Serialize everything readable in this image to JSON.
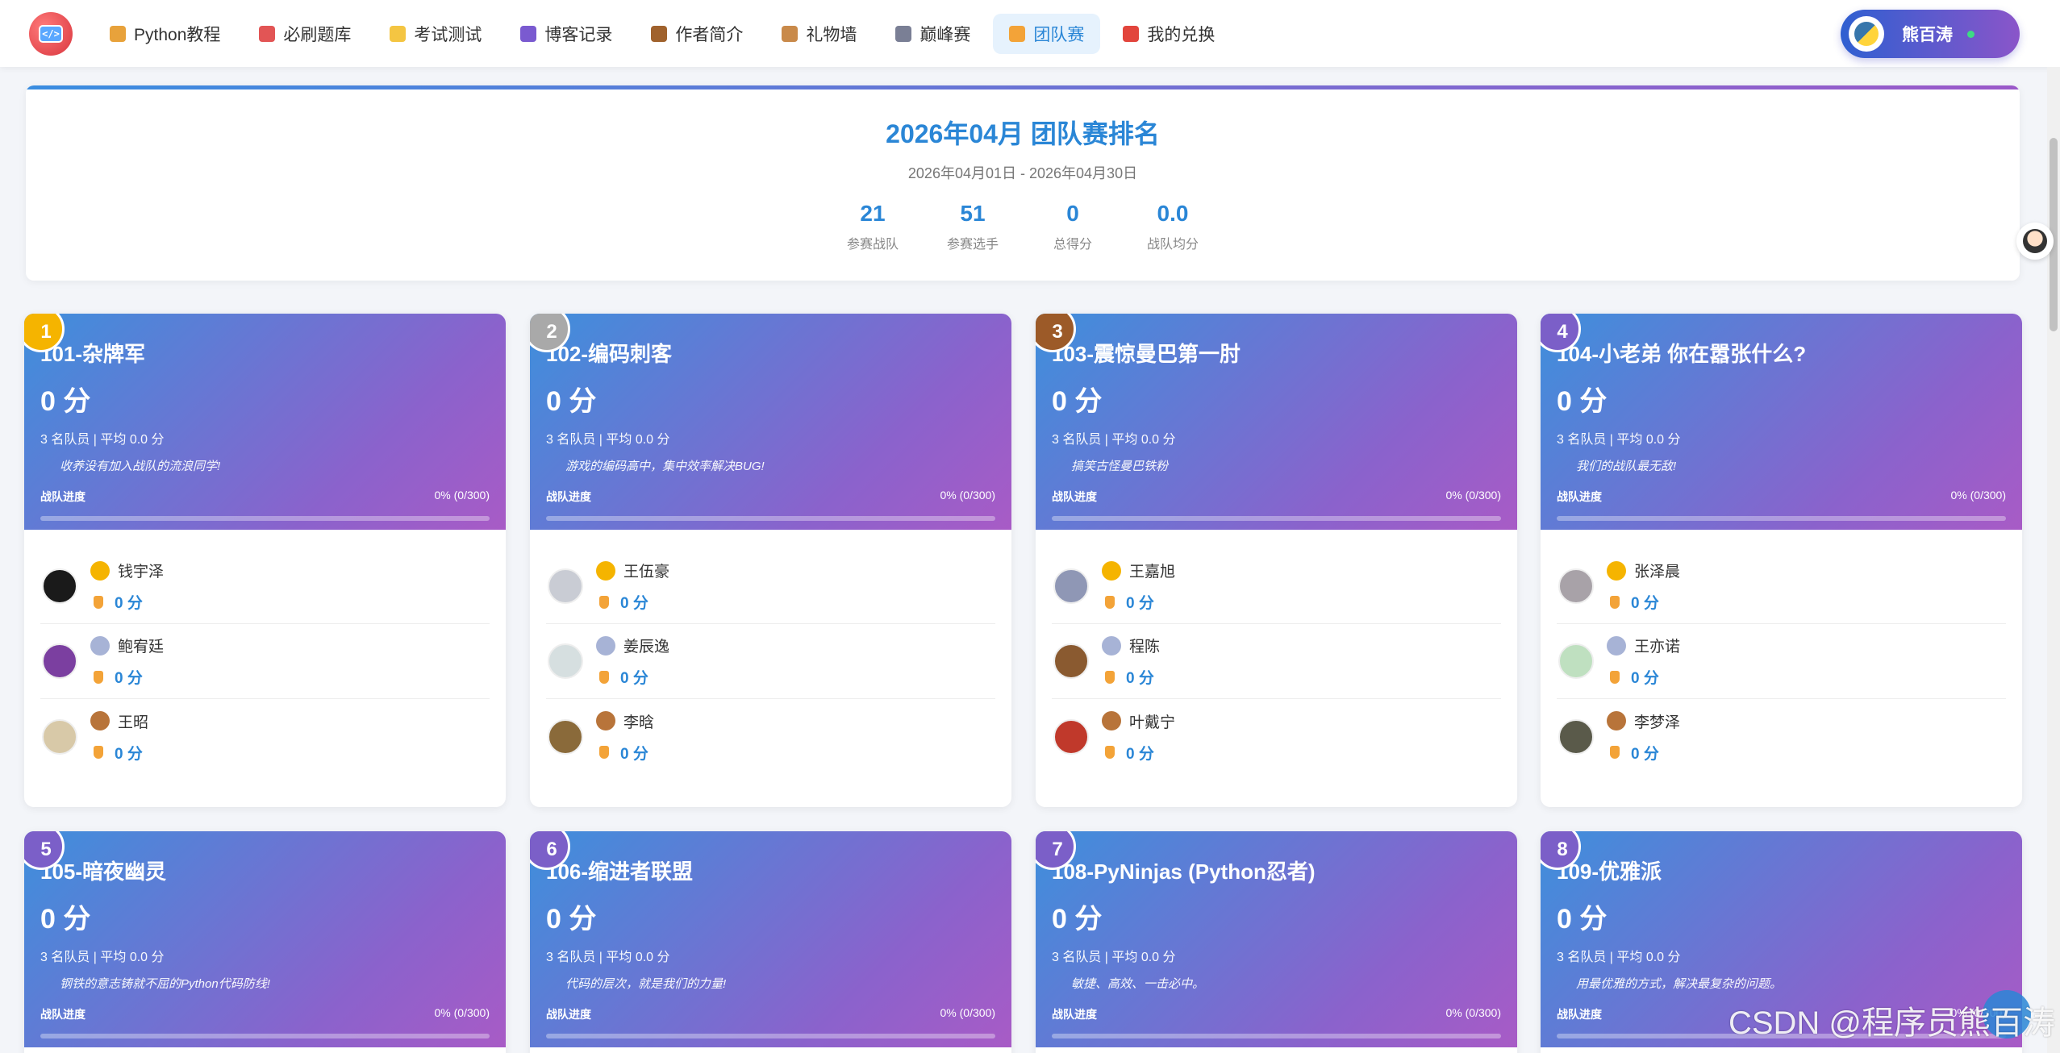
{
  "nav": {
    "items": [
      {
        "label": "Python教程",
        "icon": "scroll-icon",
        "color": "#e8a23b"
      },
      {
        "label": "必刷题库",
        "icon": "book-icon",
        "color": "#e25555"
      },
      {
        "label": "考试测试",
        "icon": "sparkle-icon",
        "color": "#f4c542"
      },
      {
        "label": "博客记录",
        "icon": "ballot-box-icon",
        "color": "#7a5ad0"
      },
      {
        "label": "作者简介",
        "icon": "bear-icon",
        "color": "#a0622d"
      },
      {
        "label": "礼物墙",
        "icon": "package-icon",
        "color": "#c98a4a"
      },
      {
        "label": "巅峰赛",
        "icon": "crossed-swords-icon",
        "color": "#7a7f95"
      },
      {
        "label": "团队赛",
        "icon": "trophy-icon",
        "color": "#f3a338"
      },
      {
        "label": "我的兑换",
        "icon": "gift-icon",
        "color": "#e2453c"
      }
    ],
    "active_index": 7,
    "user_name": "熊百涛"
  },
  "header": {
    "title": "2026年04月 团队赛排名",
    "dates": "2026年04月01日 - 2026年04月30日",
    "stats": [
      {
        "value": "21",
        "label": "参赛战队"
      },
      {
        "value": "51",
        "label": "参赛选手"
      },
      {
        "value": "0",
        "label": "总得分"
      },
      {
        "value": "0.0",
        "label": "战队均分"
      }
    ]
  },
  "teams": [
    {
      "rank": "1",
      "rank_color": "#f5b400",
      "name": "101-杂牌军",
      "score": "0 分",
      "meta": "3 名队员 | 平均 0.0 分",
      "slogan": "收养没有加入战队的流浪同学!",
      "progress_label": "战队进度",
      "progress_text": "0% (0/300)",
      "progress": 0,
      "members": [
        {
          "name": "钱宇泽",
          "score": "0 分",
          "medal": "gold",
          "avatar_color": "#1a1a1a"
        },
        {
          "name": "鲍宥廷",
          "score": "0 分",
          "medal": "silver",
          "avatar_color": "#7b3fa0"
        },
        {
          "name": "王昭",
          "score": "0 分",
          "medal": "bronze",
          "avatar_color": "#d8c9a8"
        }
      ]
    },
    {
      "rank": "2",
      "rank_color": "#a9a9a9",
      "name": "102-编码刺客",
      "score": "0 分",
      "meta": "3 名队员 | 平均 0.0 分",
      "slogan": "游戏的编码高中，集中效率解决BUG!",
      "progress_label": "战队进度",
      "progress_text": "0% (0/300)",
      "progress": 0,
      "members": [
        {
          "name": "王伍豪",
          "score": "0 分",
          "medal": "gold",
          "avatar_color": "#c9ccd4"
        },
        {
          "name": "姜辰逸",
          "score": "0 分",
          "medal": "silver",
          "avatar_color": "#d6dfe0"
        },
        {
          "name": "李晗",
          "score": "0 分",
          "medal": "bronze",
          "avatar_color": "#8a6a3a"
        }
      ]
    },
    {
      "rank": "3",
      "rank_color": "#9c5a28",
      "name": "103-震惊曼巴第一肘",
      "score": "0 分",
      "meta": "3 名队员 | 平均 0.0 分",
      "slogan": "搞笑古怪曼巴铁粉",
      "progress_label": "战队进度",
      "progress_text": "0% (0/300)",
      "progress": 0,
      "members": [
        {
          "name": "王嘉旭",
          "score": "0 分",
          "medal": "gold",
          "avatar_color": "#8f97b5"
        },
        {
          "name": "程陈",
          "score": "0 分",
          "medal": "silver",
          "avatar_color": "#8a5a30"
        },
        {
          "name": "叶戴宁",
          "score": "0 分",
          "medal": "bronze",
          "avatar_color": "#c0392b"
        }
      ]
    },
    {
      "rank": "4",
      "rank_color": "#7b5fc8",
      "name": "104-小老弟 你在嚣张什么?",
      "score": "0 分",
      "meta": "3 名队员 | 平均 0.0 分",
      "slogan": "我们的战队最无敌!",
      "progress_label": "战队进度",
      "progress_text": "0% (0/300)",
      "progress": 0,
      "members": [
        {
          "name": "张泽晨",
          "score": "0 分",
          "medal": "gold",
          "avatar_color": "#a8a2a8"
        },
        {
          "name": "王亦诺",
          "score": "0 分",
          "medal": "silver",
          "avatar_color": "#bfe0c0"
        },
        {
          "name": "李梦泽",
          "score": "0 分",
          "medal": "bronze",
          "avatar_color": "#5a5a4a"
        }
      ]
    },
    {
      "rank": "5",
      "rank_color": "#7b5fc8",
      "name": "105-暗夜幽灵",
      "score": "0 分",
      "meta": "3 名队员 | 平均 0.0 分",
      "slogan": "钢铁的意志铸就不屈的Python代码防线!",
      "progress_label": "战队进度",
      "progress_text": "0% (0/300)",
      "progress": 0,
      "members": []
    },
    {
      "rank": "6",
      "rank_color": "#7b5fc8",
      "name": "106-缩进者联盟",
      "score": "0 分",
      "meta": "3 名队员 | 平均 0.0 分",
      "slogan": "代码的层次，就是我们的力量!",
      "progress_label": "战队进度",
      "progress_text": "0% (0/300)",
      "progress": 0,
      "members": []
    },
    {
      "rank": "7",
      "rank_color": "#7b5fc8",
      "name": "108-PyNinjas (Python忍者)",
      "score": "0 分",
      "meta": "3 名队员 | 平均 0.0 分",
      "slogan": "敏捷、高效、一击必中。",
      "progress_label": "战队进度",
      "progress_text": "0% (0/300)",
      "progress": 0,
      "members": []
    },
    {
      "rank": "8",
      "rank_color": "#7b5fc8",
      "name": "109-优雅派",
      "score": "0 分",
      "meta": "3 名队员 | 平均 0.0 分",
      "slogan": "用最优雅的方式，解决最复杂的问题。",
      "progress_label": "战队进度",
      "progress_text": "0% (0/300)",
      "progress": 0,
      "members": []
    }
  ],
  "medal_colors": {
    "gold": "#f5b400",
    "silver": "#a7b3d6",
    "bronze": "#b8743a"
  },
  "watermark": "CSDN @程序员熊百涛"
}
